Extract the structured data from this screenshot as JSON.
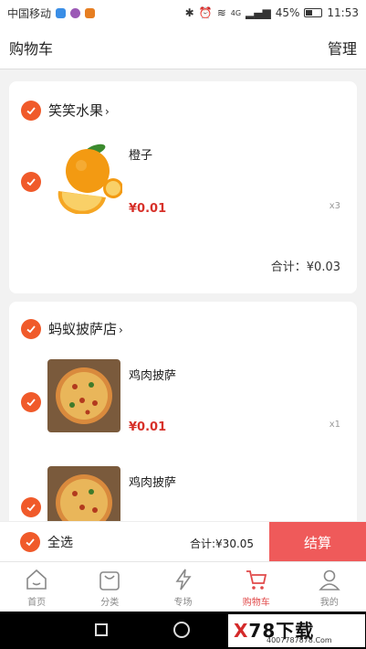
{
  "status_bar": {
    "carrier": "中国移动",
    "network": "4G",
    "battery": "45%",
    "battery_level": 0.45,
    "time": "11:53"
  },
  "header": {
    "title": "购物车",
    "manage": "管理"
  },
  "shops": [
    {
      "name": "笑笑水果",
      "items": [
        {
          "name": "橙子",
          "price": "¥0.01",
          "qty": "x3"
        }
      ],
      "subtotal": "合计：¥0.03"
    },
    {
      "name": "蚂蚁披萨店",
      "items": [
        {
          "name": "鸡肉披萨",
          "price": "¥0.01",
          "qty": "x1"
        },
        {
          "name": "鸡肉披萨"
        }
      ]
    }
  ],
  "bottom_bar": {
    "select_all": "全选",
    "total": "合计:¥30.05",
    "checkout": "结算"
  },
  "tabs": [
    {
      "label": "首页",
      "icon": "home-icon"
    },
    {
      "label": "分类",
      "icon": "bag-icon"
    },
    {
      "label": "专场",
      "icon": "lightning-icon"
    },
    {
      "label": "购物车",
      "icon": "cart-icon",
      "active": true
    },
    {
      "label": "我的",
      "icon": "user-icon"
    }
  ],
  "watermark": {
    "brand_a": "X",
    "brand_b": "78",
    "brand_c": "下载",
    "url": "4007787878.Com"
  },
  "colors": {
    "accent": "#f05a2a",
    "price": "#d7312a",
    "checkout": "#ef5a5a",
    "tab_active": "#e14a4a"
  }
}
